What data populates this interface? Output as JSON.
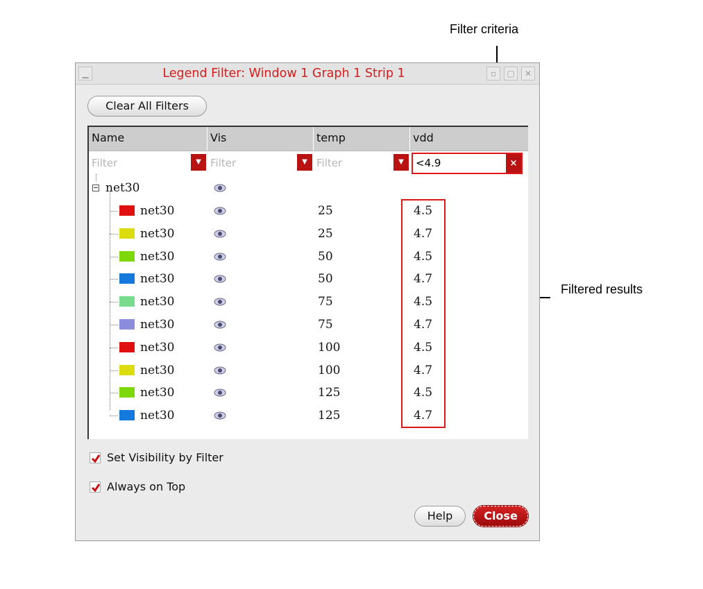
{
  "callouts": {
    "filter_criteria": "Filter criteria",
    "filtered_results": "Filtered results"
  },
  "window": {
    "title": "Legend Filter: Window 1 Graph 1 Strip 1",
    "clear_all_label": "Clear All Filters",
    "help_label": "Help",
    "close_label": "Close"
  },
  "table": {
    "columns": [
      "Name",
      "Vis",
      "temp",
      "vdd"
    ],
    "filter_placeholder": "Filter",
    "vdd_filter_value": "<4.9",
    "clear_glyph": "×",
    "group": {
      "name": "net30"
    },
    "rows": [
      {
        "name": "net30",
        "color": "#e01010",
        "temp": "25",
        "vdd": "4.5"
      },
      {
        "name": "net30",
        "color": "#dcdc10",
        "temp": "25",
        "vdd": "4.7"
      },
      {
        "name": "net30",
        "color": "#7cd80a",
        "temp": "50",
        "vdd": "4.5"
      },
      {
        "name": "net30",
        "color": "#1478dc",
        "temp": "50",
        "vdd": "4.7"
      },
      {
        "name": "net30",
        "color": "#78dc8c",
        "temp": "75",
        "vdd": "4.5"
      },
      {
        "name": "net30",
        "color": "#8c8cdc",
        "temp": "75",
        "vdd": "4.7"
      },
      {
        "name": "net30",
        "color": "#e01010",
        "temp": "100",
        "vdd": "4.5"
      },
      {
        "name": "net30",
        "color": "#dcdc10",
        "temp": "100",
        "vdd": "4.7"
      },
      {
        "name": "net30",
        "color": "#7cd80a",
        "temp": "125",
        "vdd": "4.5"
      },
      {
        "name": "net30",
        "color": "#1478dc",
        "temp": "125",
        "vdd": "4.7"
      }
    ]
  },
  "options": {
    "set_visibility_label": "Set Visibility by Filter",
    "always_on_top_label": "Always on Top",
    "set_visibility_checked": true,
    "always_on_top_checked": true
  },
  "colors": {
    "title_red": "#d21e1e",
    "highlight_red": "#e01616",
    "close_button": "#b30f0f"
  }
}
